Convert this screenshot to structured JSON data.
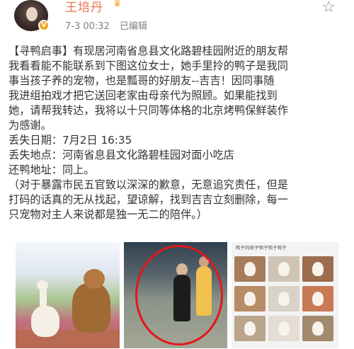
{
  "user": {
    "name": "王培丹",
    "time": "7-3 00:32",
    "edited": "已编辑"
  },
  "post": {
    "lines": [
      "【寻鸭启事】有现居河南省息县文化路碧桂园附近的朋友帮",
      "我看看能不能联系到下图这位女士，她手里拎的鸭子是我同",
      "事当孩子养的宠物，也是瓢哥的好朋友--吉吉！因同事随",
      "我进组拍戏才把它送回老家由母亲代为照顾。如果能找到",
      "她，请帮我转达，我将以十只同等体格的北京烤鸭保鲜装作",
      "为感谢。",
      "丢失日期：7月2日 16:35",
      "丢失地点：河南省息县文化路碧桂园对面小吃店",
      "还鸭地址：同上。",
      "（对于暴露市民五官致以深深的歉意，无意追究责任，但是",
      "打码的话真的无从找起，望谅解，找到吉吉立刻删除，每一",
      "只宠物对主人来说都是独一无二的陪伴。）"
    ]
  },
  "images": {
    "third_caption": "鸭子的样子鸭子鸭子鸭子"
  },
  "colors": {
    "username": "#eb7350",
    "circle": "#e3171b"
  },
  "icons": {
    "verified": "v-badge-icon",
    "member": "crown-icon",
    "favorite": "star-icon"
  }
}
